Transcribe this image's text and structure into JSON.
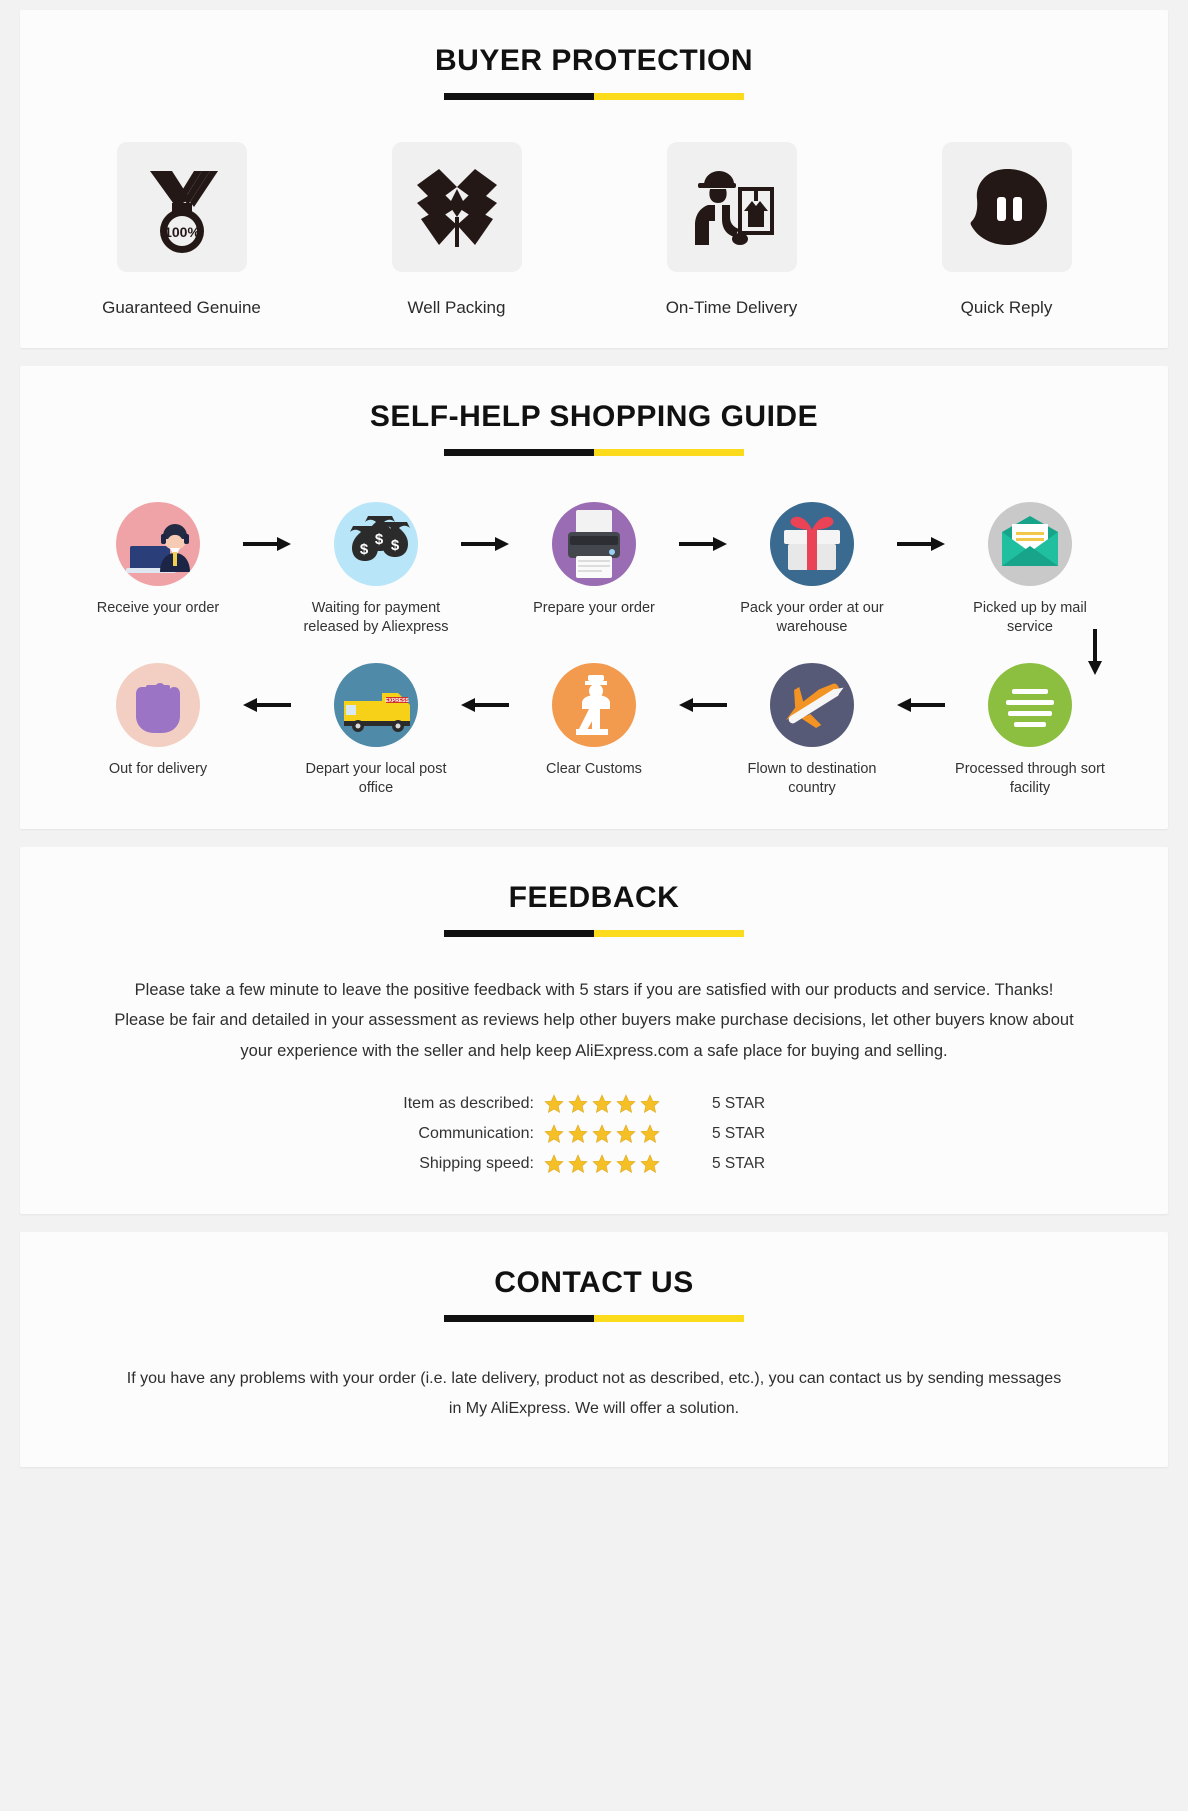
{
  "colors": {
    "rule_black": "#111111",
    "rule_yellow": "#fbdb1c",
    "card_bg": "#fcfcfc",
    "page_bg": "#f2f2f2",
    "icon_dark": "#231815",
    "tile_bg": "#f0f0f0",
    "star_gold": "#f5c026"
  },
  "buyer_protection": {
    "title": "BUYER PROTECTION",
    "items": [
      {
        "icon": "medal-100-percent-icon",
        "label": "Guaranteed Genuine",
        "badge": "100%"
      },
      {
        "icon": "open-box-icon",
        "label": "Well Packing"
      },
      {
        "icon": "delivery-person-parcel-icon",
        "label": "On-Time Delivery"
      },
      {
        "icon": "speech-bubble-quote-icon",
        "label": "Quick Reply"
      }
    ]
  },
  "shopping_guide": {
    "title": "SELF-HELP SHOPPING GUIDE",
    "row1": [
      {
        "icon": "customer-support-icon",
        "label": "Receive your order",
        "bg": "#f0a3a6"
      },
      {
        "icon": "money-bags-icon",
        "label": "Waiting for payment released by Aliexpress",
        "bg": "#b8e6f8"
      },
      {
        "icon": "printer-icon",
        "label": "Prepare your order",
        "bg": "#9a6cb4"
      },
      {
        "icon": "gift-box-icon",
        "label": "Pack your order at our warehouse",
        "bg": "#3a6a8f"
      },
      {
        "icon": "mail-envelope-icon",
        "label": "Picked up by mail service",
        "bg": "#c9c9c9"
      }
    ],
    "row2": [
      {
        "icon": "hands-package-icon",
        "label": "Out for delivery",
        "bg": "#f2cfc2"
      },
      {
        "icon": "express-van-icon",
        "label": "Depart your local post office",
        "bg": "#4f8aa8"
      },
      {
        "icon": "customs-officer-icon",
        "label": "Clear Customs",
        "bg": "#f29a4e"
      },
      {
        "icon": "airplane-icon",
        "label": "Flown to destination country",
        "bg": "#565a77"
      },
      {
        "icon": "sort-facility-icon",
        "label": "Processed through sort facility",
        "bg": "#8cbf3f"
      }
    ]
  },
  "feedback": {
    "title": "FEEDBACK",
    "paragraph": "Please take a few minute to leave the positive feedback with 5 stars if you are satisfied with our products and service. Thanks! Please be fair and detailed in your assessment as reviews help other buyers make purchase decisions, let other buyers know about your experience with the seller and help keep AliExpress.com a safe place for buying and selling.",
    "ratings": [
      {
        "label": "Item as described:",
        "stars": 5,
        "value": "5 STAR"
      },
      {
        "label": "Communication:",
        "stars": 5,
        "value": "5 STAR"
      },
      {
        "label": "Shipping speed:",
        "stars": 5,
        "value": "5 STAR"
      }
    ]
  },
  "contact": {
    "title": "CONTACT US",
    "paragraph": "If you have any problems with your order (i.e. late delivery, product not as described, etc.), you can contact us by sending messages in My AliExpress. We will offer a solution."
  }
}
